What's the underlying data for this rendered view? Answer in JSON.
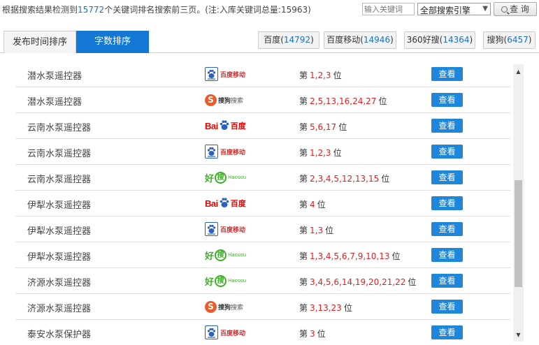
{
  "summary": {
    "prefix": "根据搜索结果检测到",
    "count": "15772",
    "suffix": "个关键词排名搜索前三页。(注:入库关键词总量:15963)"
  },
  "search": {
    "placeholder": "输入关键词",
    "engine_selected": "全部搜索引擎",
    "query_label": "查 询"
  },
  "sort_tabs": [
    {
      "label": "发布时间排序",
      "active": false
    },
    {
      "label": "字数排序",
      "active": true
    }
  ],
  "engine_tabs": [
    {
      "name": "百度",
      "count": "14792"
    },
    {
      "name": "百度移动",
      "count": "14946"
    },
    {
      "name": "360好搜",
      "count": "14364"
    },
    {
      "name": "搜狗",
      "count": "6457"
    }
  ],
  "rows": [
    {
      "keyword": "潜水泵遥控器",
      "engine": "百度移动",
      "rank_prefix": "第",
      "ranks": "1,2,3",
      "rank_suffix": "位",
      "button": "查看"
    },
    {
      "keyword": "潜水泵遥控器",
      "engine": "搜狗搜索",
      "rank_prefix": "第",
      "ranks": "2,5,13,16,24,27",
      "rank_suffix": "位",
      "button": "查看"
    },
    {
      "keyword": "云南水泵遥控器",
      "engine": "百度",
      "rank_prefix": "第",
      "ranks": "5,6,17",
      "rank_suffix": "位",
      "button": "查看"
    },
    {
      "keyword": "云南水泵遥控器",
      "engine": "百度移动",
      "rank_prefix": "第",
      "ranks": "1,2,3",
      "rank_suffix": "位",
      "button": "查看"
    },
    {
      "keyword": "云南水泵遥控器",
      "engine": "好搜",
      "rank_prefix": "第",
      "ranks": "2,3,4,5,12,13,15",
      "rank_suffix": "位",
      "button": "查看"
    },
    {
      "keyword": "伊犁水泵遥控器",
      "engine": "百度",
      "rank_prefix": "第",
      "ranks": "4",
      "rank_suffix": "位",
      "button": "查看"
    },
    {
      "keyword": "伊犁水泵遥控器",
      "engine": "百度移动",
      "rank_prefix": "第",
      "ranks": "1,3",
      "rank_suffix": "位",
      "button": "查看"
    },
    {
      "keyword": "伊犁水泵遥控器",
      "engine": "好搜",
      "rank_prefix": "第",
      "ranks": "1,3,4,5,6,7,9,10,13",
      "rank_suffix": "位",
      "button": "查看"
    },
    {
      "keyword": "济源水泵遥控器",
      "engine": "好搜",
      "rank_prefix": "第",
      "ranks": "3,4,5,6,14,19,20,21,22",
      "rank_suffix": "位",
      "button": "查看"
    },
    {
      "keyword": "济源水泵遥控器",
      "engine": "搜狗搜索",
      "rank_prefix": "第",
      "ranks": "3,13,23",
      "rank_suffix": "位",
      "button": "查看"
    },
    {
      "keyword": "泰安水泵保护器",
      "engine": "百度移动",
      "rank_prefix": "第",
      "ranks": "3",
      "rank_suffix": "位",
      "button": "查看"
    }
  ],
  "logo_text": {
    "baidu_mobile": "百度移动",
    "sogou_brand": "搜狗",
    "sogou_word": "搜索",
    "baidu_latin": "Bai",
    "baidu_cn": "百度",
    "haosou_cn": "好",
    "haosou_glyph": "搜",
    "haosou_en": "Haosou"
  },
  "colors": {
    "accent": "#1477d4",
    "button": "#1f86d9",
    "rank": "#e02020",
    "count": "#1a6fc9"
  }
}
